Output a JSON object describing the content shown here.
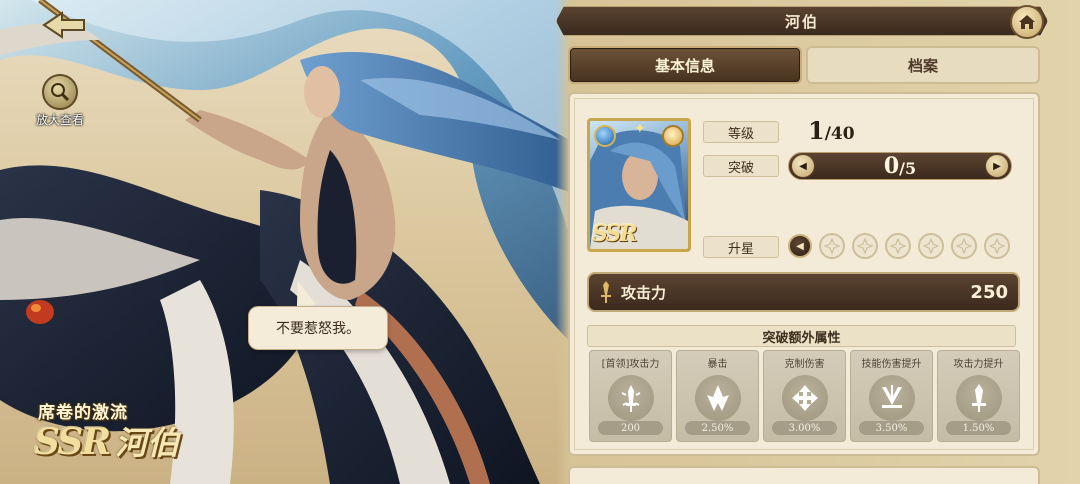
{
  "header": {
    "title": "河伯"
  },
  "tabs": [
    {
      "label": "基本信息",
      "active": true
    },
    {
      "label": "档案",
      "active": false
    }
  ],
  "left": {
    "zoom_label": "放大查看",
    "speech": "不要惹怒我。",
    "subtitle": "席卷的激流",
    "rarity": "SSR",
    "name": "河伯"
  },
  "card": {
    "rarity": "SSR",
    "level_label": "等级",
    "level_current": "1",
    "level_max": "/40",
    "breakthrough_label": "突破",
    "breakthrough_current": "0",
    "breakthrough_max": "/5",
    "star_label": "升星",
    "star_slots": 6,
    "attack_label": "攻击力",
    "attack_value": "250",
    "extra_title": "突破额外属性",
    "extra_attrs": [
      {
        "name": "[首领]攻击力",
        "value": "200",
        "icon": "sword-sparkle-icon"
      },
      {
        "name": "暴击",
        "value": "2.50%",
        "icon": "crit-shard-icon"
      },
      {
        "name": "克制伤害",
        "value": "3.00%",
        "icon": "counter-arrows-icon"
      },
      {
        "name": "技能伤害提升",
        "value": "3.50%",
        "icon": "skill-swords-icon"
      },
      {
        "name": "攻击力提升",
        "value": "1.50%",
        "icon": "attack-up-icon"
      }
    ]
  },
  "colors": {
    "panel_dark": "#4a3625",
    "panel_light": "#f3ebd8",
    "gold": "#c9a64d",
    "hair_blue": "#4f7fb8"
  }
}
